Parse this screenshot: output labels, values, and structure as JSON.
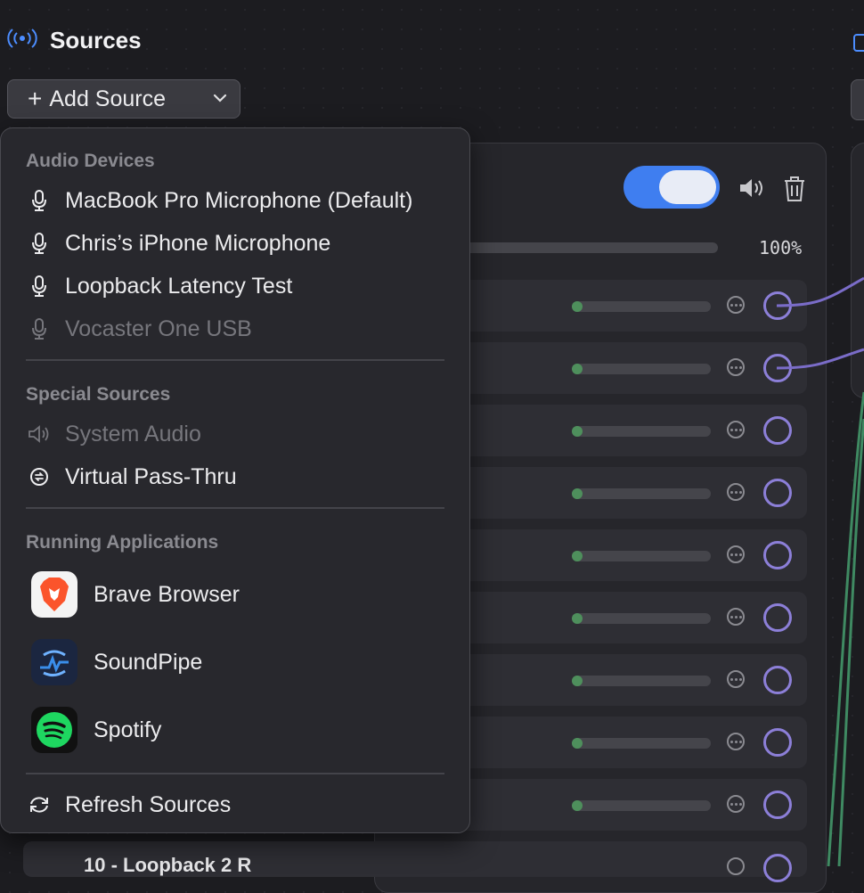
{
  "header": {
    "title": "Sources",
    "icon": "broadcast-icon"
  },
  "toolbar": {
    "add_source_label": "Add Source"
  },
  "source_panel": {
    "enabled": true,
    "volume_percent": "100%",
    "volume_level": 1.0
  },
  "rows": [
    {
      "connected": true
    },
    {
      "connected": true
    },
    {
      "connected": false
    },
    {
      "connected": false
    },
    {
      "connected": false
    },
    {
      "connected": false
    },
    {
      "connected": false
    },
    {
      "connected": false
    },
    {
      "connected": false
    }
  ],
  "partial_row_label": "10 - Loopback 2 R",
  "menu": {
    "audio_devices_header": "Audio Devices",
    "audio_devices": [
      {
        "label": "MacBook Pro Microphone (Default)",
        "enabled": true
      },
      {
        "label": "Chris’s iPhone Microphone",
        "enabled": true
      },
      {
        "label": "Loopback Latency Test",
        "enabled": true
      },
      {
        "label": "Vocaster One USB",
        "enabled": false
      }
    ],
    "special_header": "Special Sources",
    "special": [
      {
        "label": "System Audio",
        "enabled": false,
        "icon": "speaker-icon"
      },
      {
        "label": "Virtual Pass-Thru",
        "enabled": true,
        "icon": "passthru-icon"
      }
    ],
    "apps_header": "Running Applications",
    "apps": [
      {
        "label": "Brave Browser",
        "icon": "brave-icon"
      },
      {
        "label": "SoundPipe",
        "icon": "soundpipe-icon"
      },
      {
        "label": "Spotify",
        "icon": "spotify-icon"
      }
    ],
    "refresh_label": "Refresh Sources"
  },
  "colors": {
    "accent": "#3f7ef0",
    "port": "#8c7fd8",
    "wire_purple": "#7a6cc8",
    "wire_green": "#3f8a62"
  }
}
